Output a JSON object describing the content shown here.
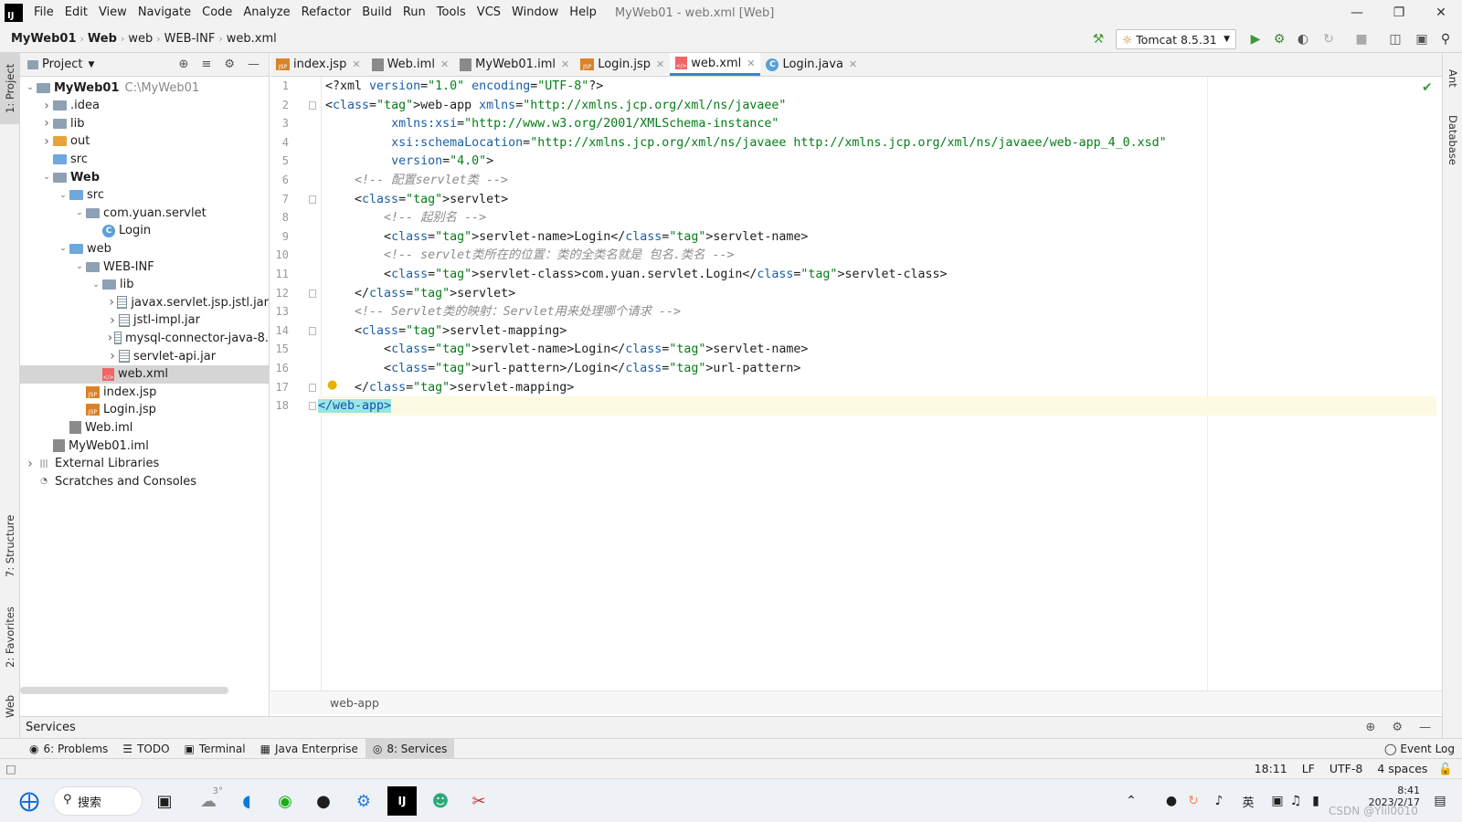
{
  "window": {
    "title": "MyWeb01 - web.xml [Web]",
    "logo": "IJ"
  },
  "menu": [
    "File",
    "Edit",
    "View",
    "Navigate",
    "Code",
    "Analyze",
    "Refactor",
    "Build",
    "Run",
    "Tools",
    "VCS",
    "Window",
    "Help"
  ],
  "breadcrumb": [
    "MyWeb01",
    "Web",
    "web",
    "WEB-INF",
    "web.xml"
  ],
  "run_config": "Tomcat 8.5.31",
  "left_tool_tabs": [
    "1: Project",
    "7: Structure",
    "2: Favorites",
    "Web"
  ],
  "right_tool_tabs": [
    "Ant",
    "Database"
  ],
  "project_panel": {
    "title": "Project"
  },
  "tree": [
    {
      "label": "MyWeb01",
      "extra": "C:\\MyWeb01",
      "bold": true,
      "indent": 0,
      "arrow": "v",
      "icon": "folder"
    },
    {
      "label": ".idea",
      "indent": 1,
      "arrow": ">",
      "icon": "folder"
    },
    {
      "label": "lib",
      "indent": 1,
      "arrow": ">",
      "icon": "folder"
    },
    {
      "label": "out",
      "indent": 1,
      "arrow": ">",
      "icon": "folder-orange"
    },
    {
      "label": "src",
      "indent": 1,
      "arrow": "",
      "icon": "folder-blue"
    },
    {
      "label": "Web",
      "bold": true,
      "indent": 1,
      "arrow": "v",
      "icon": "folder"
    },
    {
      "label": "src",
      "indent": 2,
      "arrow": "v",
      "icon": "folder-blue"
    },
    {
      "label": "com.yuan.servlet",
      "indent": 3,
      "arrow": "v",
      "icon": "folder"
    },
    {
      "label": "Login",
      "indent": 4,
      "arrow": "",
      "icon": "class"
    },
    {
      "label": "web",
      "indent": 2,
      "arrow": "v",
      "icon": "folder-blue"
    },
    {
      "label": "WEB-INF",
      "indent": 3,
      "arrow": "v",
      "icon": "folder"
    },
    {
      "label": "lib",
      "indent": 4,
      "arrow": "v",
      "icon": "folder"
    },
    {
      "label": "javax.servlet.jsp.jstl.jar",
      "indent": 5,
      "arrow": ">",
      "icon": "jar"
    },
    {
      "label": "jstl-impl.jar",
      "indent": 5,
      "arrow": ">",
      "icon": "jar"
    },
    {
      "label": "mysql-connector-java-8.",
      "indent": 5,
      "arrow": ">",
      "icon": "jar"
    },
    {
      "label": "servlet-api.jar",
      "indent": 5,
      "arrow": ">",
      "icon": "jar"
    },
    {
      "label": "web.xml",
      "indent": 4,
      "arrow": "",
      "icon": "xml",
      "selected": true
    },
    {
      "label": "index.jsp",
      "indent": 3,
      "arrow": "",
      "icon": "jsp"
    },
    {
      "label": "Login.jsp",
      "indent": 3,
      "arrow": "",
      "icon": "jsp"
    },
    {
      "label": "Web.iml",
      "indent": 2,
      "arrow": "",
      "icon": "iml"
    },
    {
      "label": "MyWeb01.iml",
      "indent": 1,
      "arrow": "",
      "icon": "iml"
    },
    {
      "label": "External Libraries",
      "indent": 0,
      "arrow": ">",
      "icon": "libs"
    },
    {
      "label": "Scratches and Consoles",
      "indent": 0,
      "arrow": "",
      "icon": "scratch"
    }
  ],
  "editor_tabs": [
    {
      "label": "index.jsp",
      "icon": "jsp"
    },
    {
      "label": "Web.iml",
      "icon": "iml"
    },
    {
      "label": "MyWeb01.iml",
      "icon": "iml"
    },
    {
      "label": "Login.jsp",
      "icon": "jsp"
    },
    {
      "label": "web.xml",
      "icon": "xml",
      "active": true
    },
    {
      "label": "Login.java",
      "icon": "class"
    }
  ],
  "code_lines": [
    "<?xml version=\"1.0\" encoding=\"UTF-8\"?>",
    "<web-app xmlns=\"http://xmlns.jcp.org/xml/ns/javaee\"",
    "         xmlns:xsi=\"http://www.w3.org/2001/XMLSchema-instance\"",
    "         xsi:schemaLocation=\"http://xmlns.jcp.org/xml/ns/javaee http://xmlns.jcp.org/xml/ns/javaee/web-app_4_0.xsd\"",
    "         version=\"4.0\">",
    "    <!-- 配置servlet类 -->",
    "    <servlet>",
    "        <!-- 起别名 -->",
    "        <servlet-name>Login</servlet-name>",
    "        <!-- servlet类所在的位置：类的全类名就是 包名.类名 -->",
    "        <servlet-class>com.yuan.servlet.Login</servlet-class>",
    "    </servlet>",
    "    <!-- Servlet类的映射：Servlet用来处理哪个请求 -->",
    "    <servlet-mapping>",
    "        <servlet-name>Login</servlet-name>",
    "        <url-pattern>/Login</url-pattern>",
    "    </servlet-mapping>",
    "</web-app>"
  ],
  "code_breadcrumb": "web-app",
  "services_label": "Services",
  "bottom_tabs": [
    {
      "label": "6: Problems",
      "icon": "problems"
    },
    {
      "label": "TODO",
      "icon": "todo"
    },
    {
      "label": "Terminal",
      "icon": "terminal"
    },
    {
      "label": "Java Enterprise",
      "icon": "jee"
    },
    {
      "label": "8: Services",
      "icon": "services",
      "active": true
    }
  ],
  "event_log": "Event Log",
  "status": {
    "position": "18:11",
    "line_sep": "LF",
    "encoding": "UTF-8",
    "indent": "4 spaces"
  },
  "taskbar": {
    "search": "搜索",
    "weather": "3°",
    "ime": "英",
    "time": "8:41",
    "date": "2023/2/17",
    "watermark": "CSDN @Ylil0010"
  }
}
